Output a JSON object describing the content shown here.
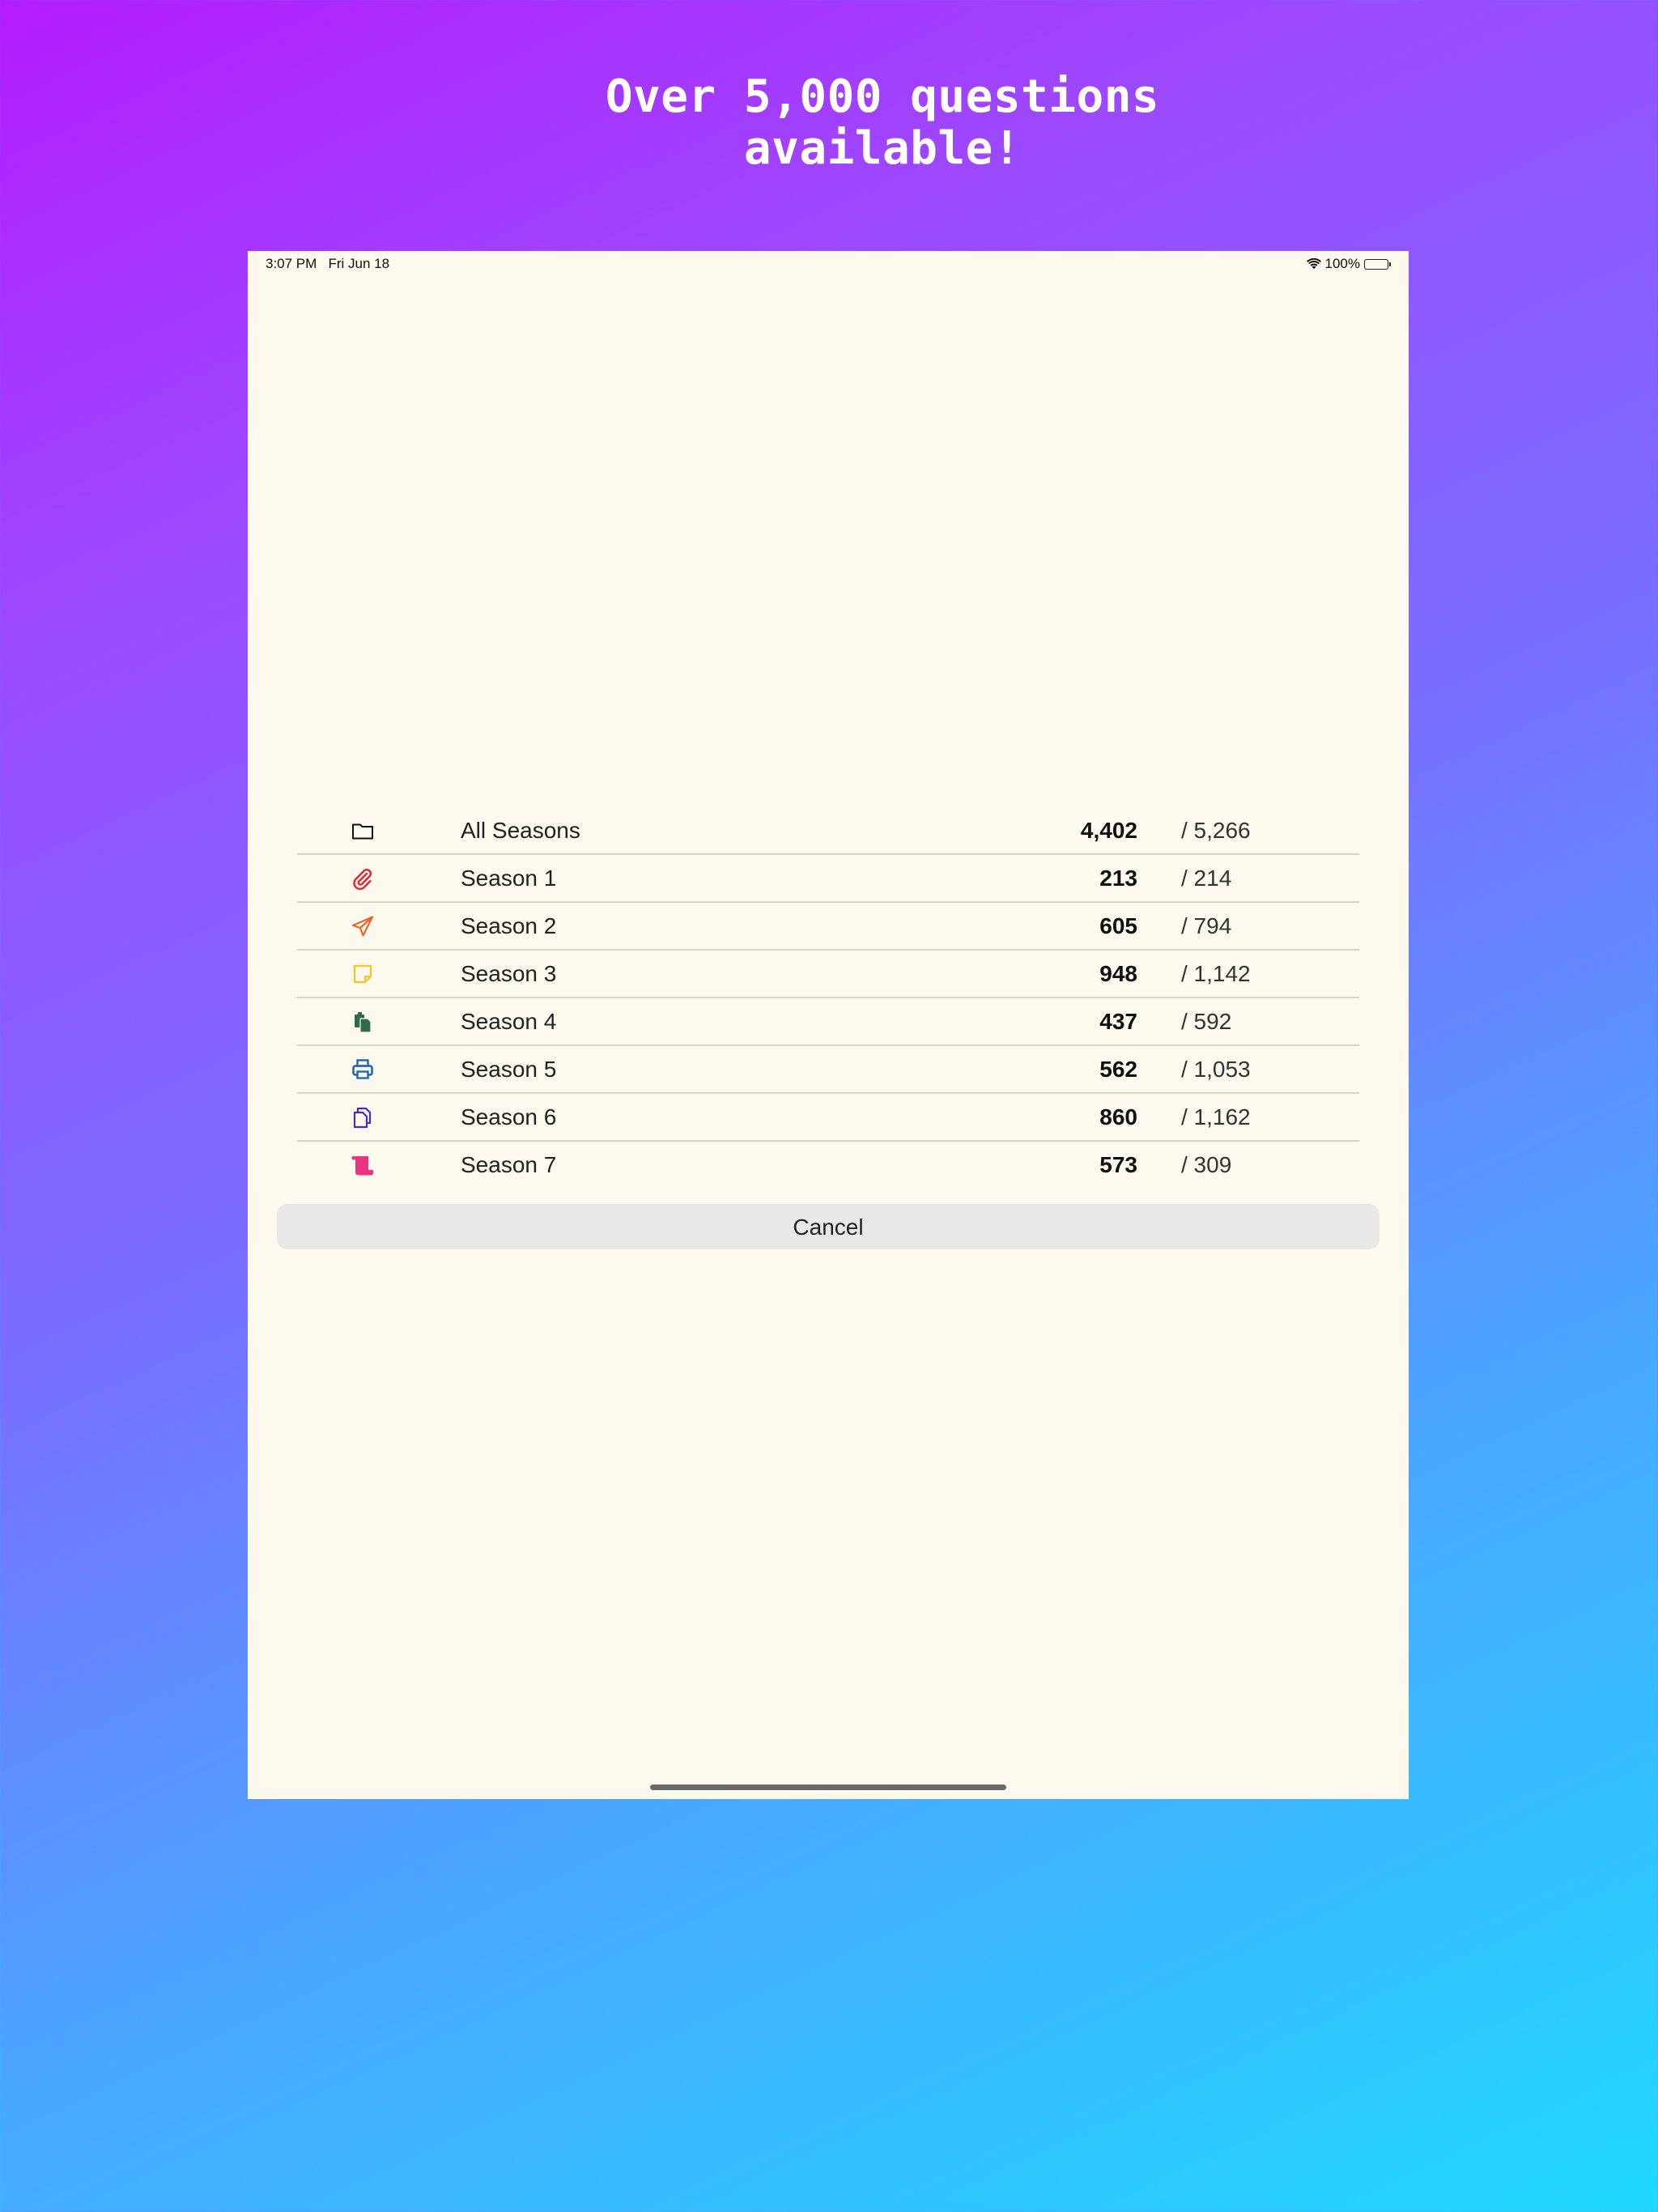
{
  "headline": {
    "line1": "Over 5,000 questions",
    "line2": "available!"
  },
  "status_bar": {
    "time": "3:07 PM",
    "date": "Fri Jun 18",
    "battery": "100%",
    "wifi_icon": "wifi-icon",
    "battery_icon": "battery-icon"
  },
  "seasons": [
    {
      "label": "All Seasons",
      "count": "4,402",
      "total": "/ 5,266",
      "icon": "folder-icon",
      "icon_color": "#111111"
    },
    {
      "label": "Season 1",
      "count": "213",
      "total": "/ 214",
      "icon": "paperclip-icon",
      "icon_color": "#e0242e"
    },
    {
      "label": "Season 2",
      "count": "605",
      "total": "/ 794",
      "icon": "paper-plane-icon",
      "icon_color": "#e8652c"
    },
    {
      "label": "Season 3",
      "count": "948",
      "total": "/ 1,142",
      "icon": "sticky-note-icon",
      "icon_color": "#f3c623"
    },
    {
      "label": "Season 4",
      "count": "437",
      "total": "/ 592",
      "icon": "clipboard-documents-icon",
      "icon_color": "#2e6b48"
    },
    {
      "label": "Season 5",
      "count": "562",
      "total": "/ 1,053",
      "icon": "printer-icon",
      "icon_color": "#2067b4"
    },
    {
      "label": "Season 6",
      "count": "860",
      "total": "/ 1,162",
      "icon": "copy-documents-icon",
      "icon_color": "#4a2bc4"
    },
    {
      "label": "Season 7",
      "count": "573",
      "total": "/ 309",
      "icon": "scroll-icon",
      "icon_color": "#e83581"
    }
  ],
  "cancel_label": "Cancel",
  "colors": {
    "screen_background": "#fdf9ee",
    "divider": "#d6d2c9",
    "cancel_background": "#e8e8e6",
    "gradient_start": "#b41cff",
    "gradient_end": "#1fd8ff"
  }
}
